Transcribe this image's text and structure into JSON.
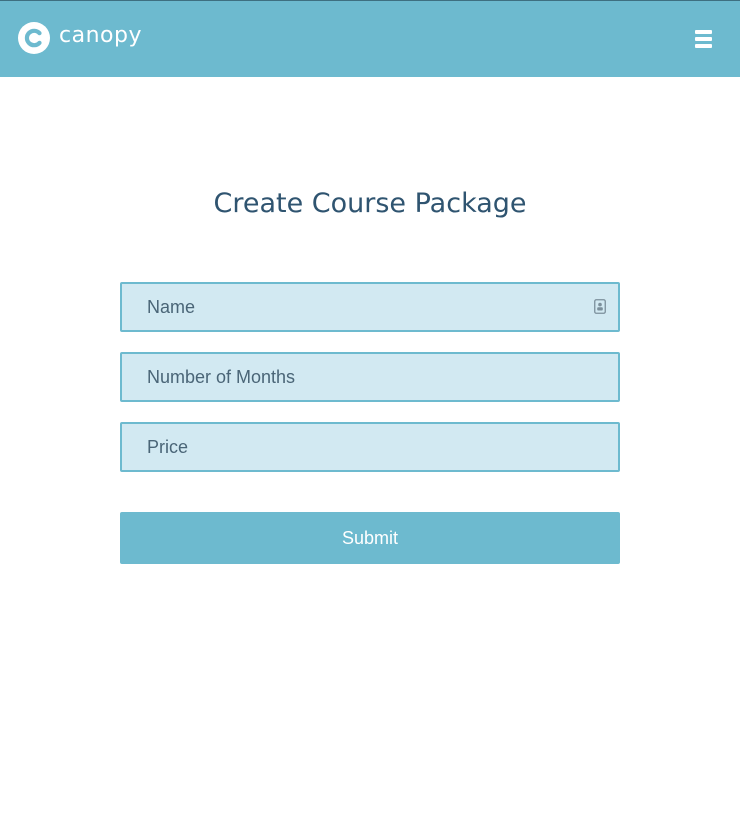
{
  "header": {
    "brand_name": "canopy",
    "logo_icon": "canopy-logo-icon",
    "menu_icon": "hamburger-menu-icon"
  },
  "main": {
    "title": "Create Course Package",
    "form": {
      "fields": [
        {
          "name": "name",
          "placeholder": "Name",
          "value": "",
          "icon": "contact-card-icon"
        },
        {
          "name": "months",
          "placeholder": "Number of Months",
          "value": ""
        },
        {
          "name": "price",
          "placeholder": "Price",
          "value": ""
        }
      ],
      "submit_label": "Submit"
    }
  },
  "colors": {
    "header_bg": "#6dbacf",
    "title_text": "#2f5470",
    "field_bg": "#d2e9f2",
    "field_border": "#6dbacf",
    "button_bg": "#6dbacf",
    "button_text": "#ffffff"
  }
}
